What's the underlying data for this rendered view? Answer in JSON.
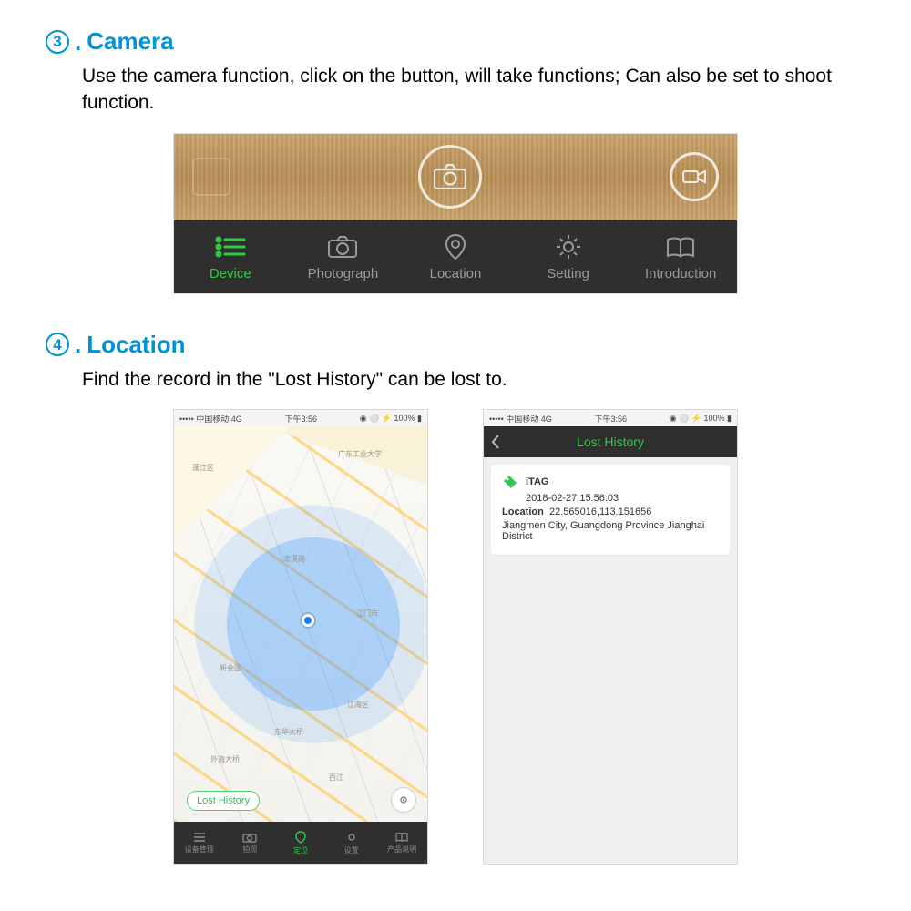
{
  "section3": {
    "num": "3",
    "title": "Camera",
    "desc": "Use the camera function, click on the button, will take functions; Can also be set to shoot function."
  },
  "tabbar": {
    "items": [
      {
        "label": "Device"
      },
      {
        "label": "Photograph"
      },
      {
        "label": "Location"
      },
      {
        "label": "Setting"
      },
      {
        "label": "Introduction"
      }
    ]
  },
  "section4": {
    "num": "4",
    "title": "Location",
    "desc": "Find the record in the  \"Lost History\"  can be lost to."
  },
  "statusbar": {
    "left": "••••• 中国移动 4G",
    "center": "下午3:56",
    "right": "◉ ⚪ ⚡ 100% ▮"
  },
  "map": {
    "lost_history": "Lost History",
    "labels": [
      "江门市",
      "蓬江区",
      "广东工业大学",
      "江海区",
      "新会区",
      "外海大桥",
      "龙溪路",
      "东华大桥",
      "西江"
    ]
  },
  "mini_tabs": [
    "设备管理",
    "拍照",
    "定位",
    "设置",
    "产品说明"
  ],
  "lost_history": {
    "header": "Lost History",
    "device": "iTAG",
    "timestamp": "2018-02-27 15:56:03",
    "location_label": "Location",
    "coords": "22.565016,113.151656",
    "address": "Jiangmen City, Guangdong Province Jianghai District"
  }
}
